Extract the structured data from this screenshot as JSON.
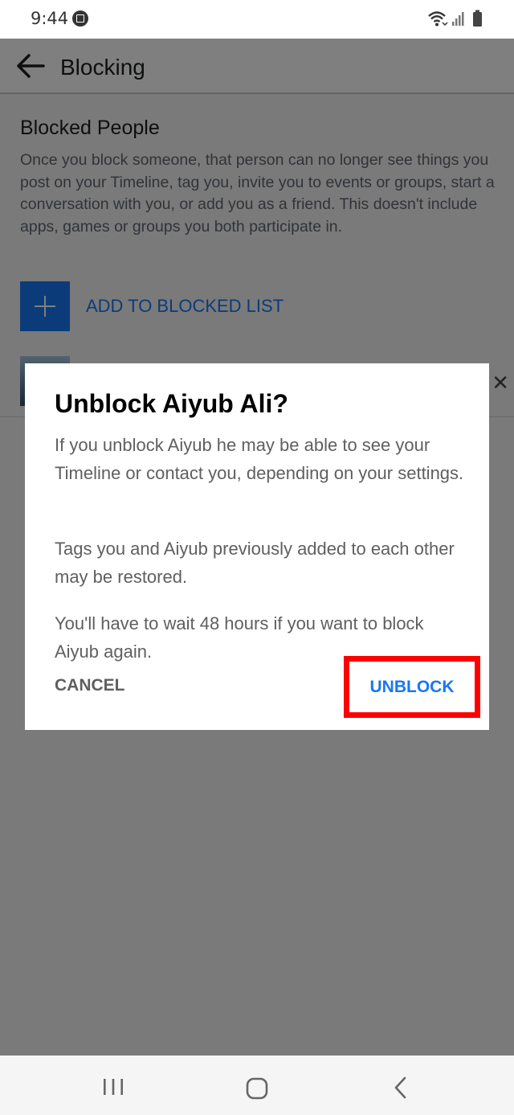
{
  "status_bar": {
    "time": "9:44"
  },
  "app_bar": {
    "title": "Blocking"
  },
  "blocked_people": {
    "title": "Blocked People",
    "description": "Once you block someone, that person can no longer see things you post on your Timeline, tag you, invite you to events or groups, start a conversation with you, or add you as a friend. This doesn't include apps, games or groups you both participate in.",
    "add_label": "ADD TO BLOCKED LIST"
  },
  "dialog": {
    "title": "Unblock Aiyub Ali?",
    "paragraph_1": "If you unblock Aiyub he may be able to see your Timeline or contact you, depending on your settings.",
    "paragraph_2": "Tags you and Aiyub previously added to each other may be restored.",
    "paragraph_3": "You'll have to wait 48 hours if you want to block Aiyub again.",
    "cancel_label": "CANCEL",
    "unblock_label": "UNBLOCK"
  },
  "colors": {
    "accent": "#1877f2",
    "highlight_box": "#ff0000",
    "scrim": "#7f7f7f"
  },
  "icons": {
    "back": "arrow-left",
    "add": "plus",
    "remove": "close-x",
    "nav_recent": "recent-apps-lines",
    "nav_home": "home-rounded-square",
    "nav_back": "chevron-left"
  }
}
